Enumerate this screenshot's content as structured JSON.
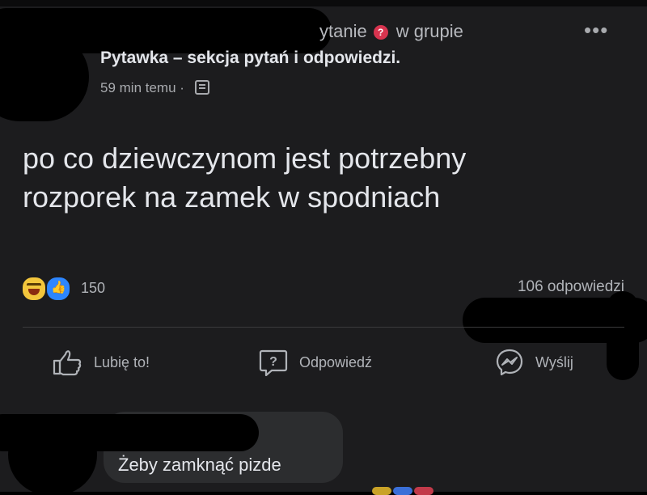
{
  "post": {
    "header_suffix": "ytanie",
    "question_badge": "?",
    "in_group": "w grupie",
    "group_name": "Pytawka – sekcja pytań i odpowiedzi.",
    "time": "59 min temu",
    "more": "•••",
    "text_line1": "po co dziewczynom jest potrzebny",
    "text_line2": "rozporek na zamek w spodniach"
  },
  "stats": {
    "reaction_count": "150",
    "replies": "106 odpowiedzi"
  },
  "actions": {
    "like": "Lubię to!",
    "answer": "Odpowiedź",
    "send": "Wyślij"
  },
  "comment": {
    "text": "Żeby zamknąć pizde"
  },
  "colors": {
    "background": "#1c1c1e",
    "text": "#e4e6eb",
    "muted": "#b0b3b8",
    "badge": "#d8344f",
    "like_blue": "#2d86ff",
    "haha_yellow": "#f3c63c"
  }
}
